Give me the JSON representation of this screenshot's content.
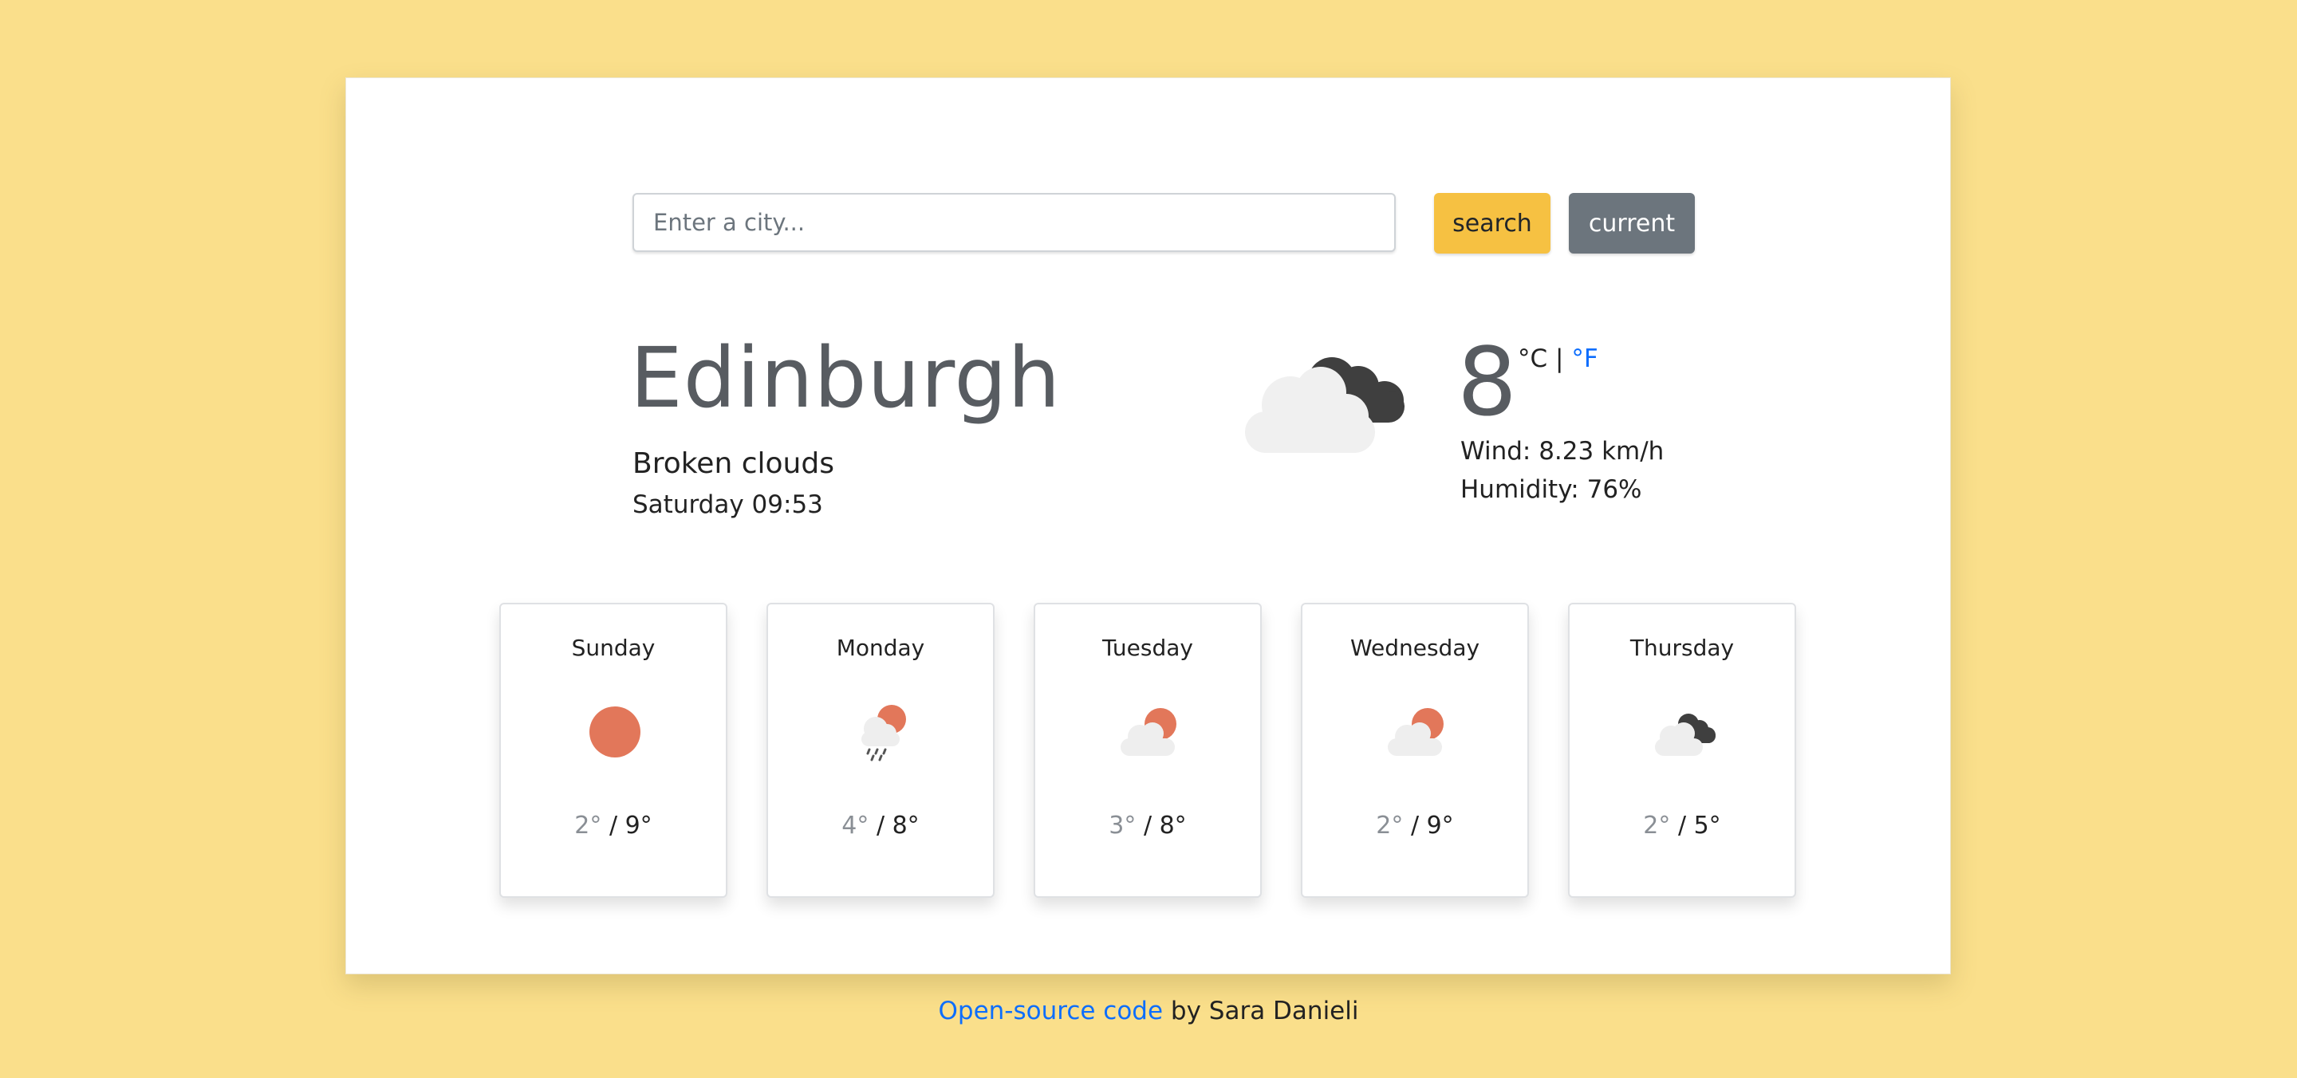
{
  "search": {
    "placeholder": "Enter a city...",
    "search_label": "search",
    "current_label": "current"
  },
  "current": {
    "city": "Edinburgh",
    "description": "Broken clouds",
    "datetime": "Saturday 09:53",
    "temperature": "8",
    "unit_c": "°C",
    "unit_sep": "|",
    "unit_f": "°F",
    "wind": "Wind: 8.23 km/h",
    "humidity": "Humidity: 76%",
    "icon": "broken-clouds-icon"
  },
  "forecast": [
    {
      "day": "Sunday",
      "min": "2°",
      "sep": "/",
      "max": "9°",
      "icon": "sun-icon"
    },
    {
      "day": "Monday",
      "min": "4°",
      "sep": "/",
      "max": "8°",
      "icon": "rain-sun-icon"
    },
    {
      "day": "Tuesday",
      "min": "3°",
      "sep": "/",
      "max": "8°",
      "icon": "cloud-sun-icon"
    },
    {
      "day": "Wednesday",
      "min": "2°",
      "sep": "/",
      "max": "9°",
      "icon": "cloud-sun-icon"
    },
    {
      "day": "Thursday",
      "min": "2°",
      "sep": "/",
      "max": "5°",
      "icon": "broken-clouds-icon"
    }
  ],
  "footer": {
    "link_text": "Open-source code",
    "suffix": " by Sara Danieli"
  },
  "colors": {
    "background": "#fadf8b",
    "search_button": "#f6c142",
    "current_button": "#6c757d",
    "link": "#0d6efd",
    "sun": "#e2775a",
    "dark_cloud": "#3f3f3f",
    "light_cloud": "#eeeeee"
  }
}
